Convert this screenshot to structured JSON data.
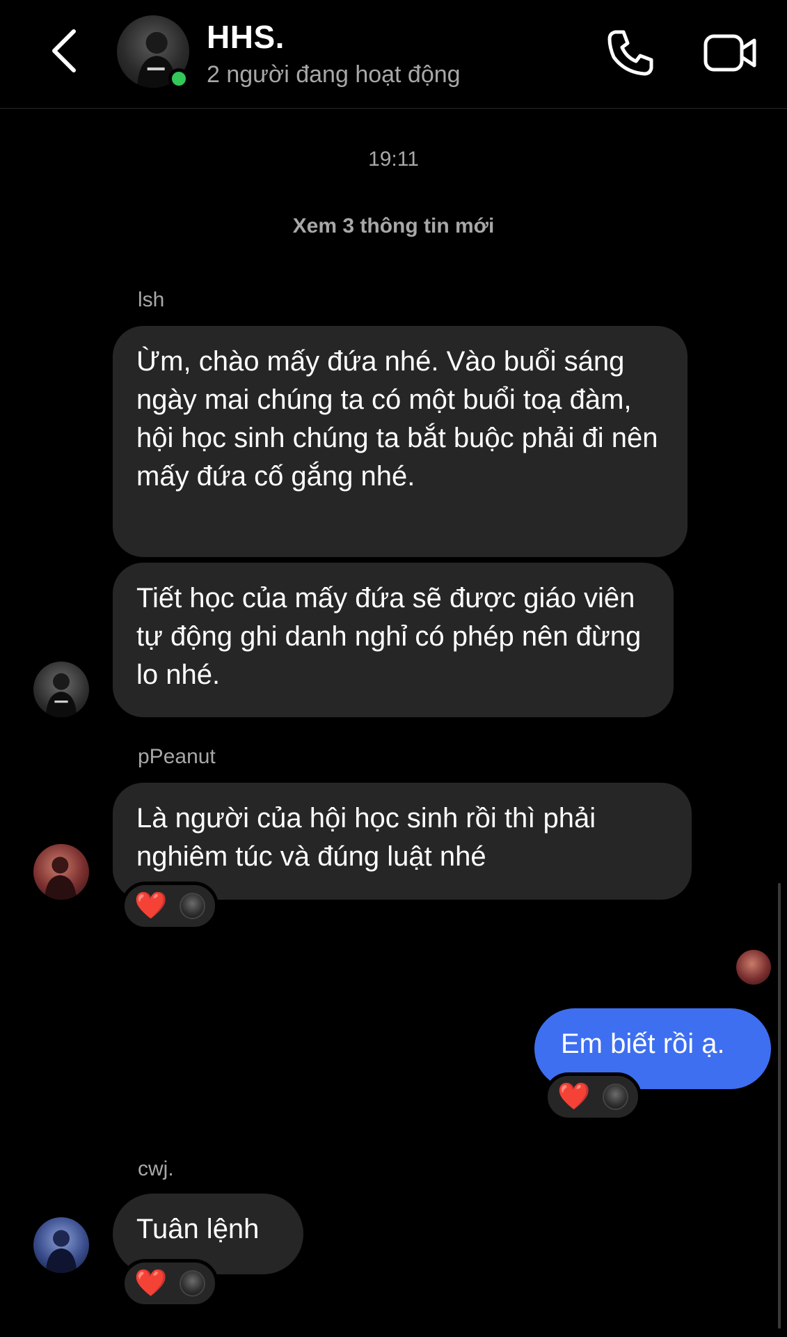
{
  "header": {
    "title": "HHS.",
    "status": "2 người đang hoạt động",
    "back_icon": "chevron-left-icon",
    "call_icon": "phone-icon",
    "video_icon": "video-camera-icon"
  },
  "timestamp": "19:11",
  "system_link": "Xem 3 thông tin mới",
  "messages": [
    {
      "sender": "lsh",
      "texts": [
        "Ừm, chào mấy đứa nhé. Vào buổi sáng ngày mai chúng ta có một buổi toạ đàm, hội học sinh chúng ta bắt buộc phải đi nên mấy đứa cố gắng nhé.",
        "Tiết học của mấy đứa sẽ được giáo viên tự động ghi danh nghỉ có phép nên đừng lo nhé."
      ]
    },
    {
      "sender": "pPeanut",
      "texts": [
        "Là người của hội học sinh rồi thì phải nghiêm túc và đúng luật nhé"
      ],
      "reaction": "❤️"
    },
    {
      "sender": "me",
      "texts": [
        "Em biết rồi ạ."
      ],
      "reaction": "❤️"
    },
    {
      "sender": "cwj.",
      "texts": [
        "Tuân lệnh"
      ],
      "reaction": "❤️"
    }
  ],
  "colors": {
    "background": "#000000",
    "incoming_bubble": "#262626",
    "outgoing_bubble": "#3e6ff0",
    "online": "#34c759",
    "secondary_text": "#a8a8a8",
    "heart": "#ff3040"
  }
}
